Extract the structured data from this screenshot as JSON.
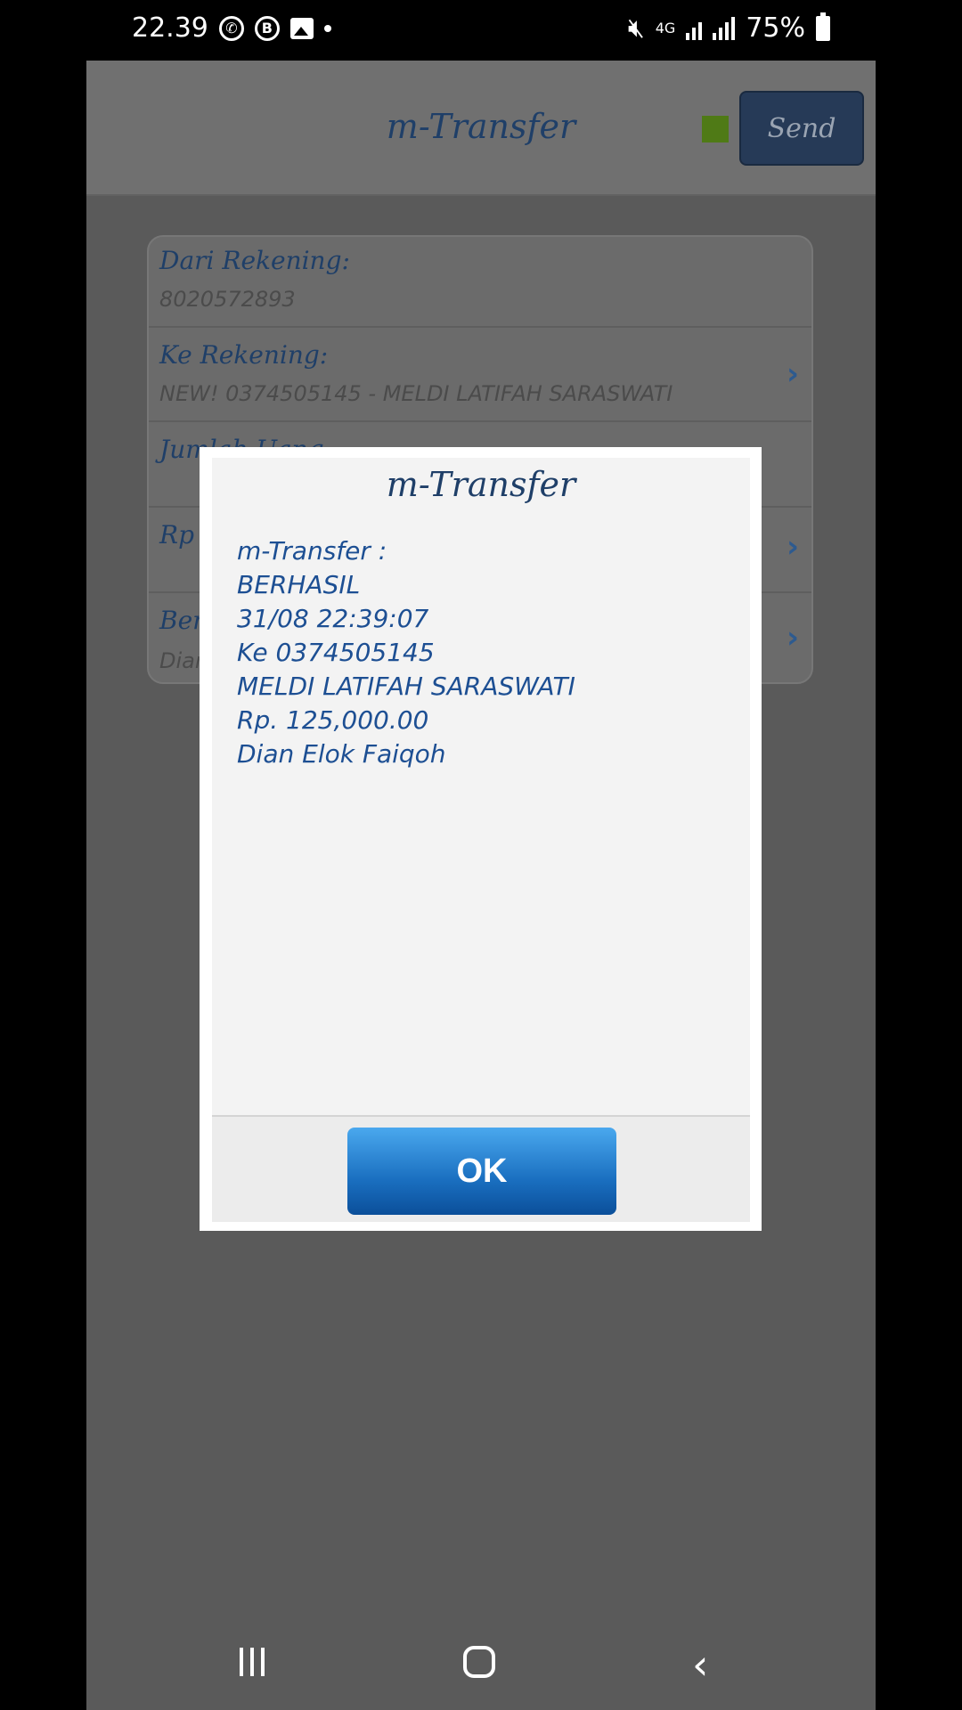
{
  "status_bar": {
    "time": "22.39",
    "battery": "75%",
    "network": "4G",
    "icons": [
      "whatsapp-icon",
      "b-circle-icon",
      "gallery-icon",
      "mute-icon",
      "signal-icon",
      "battery-icon"
    ]
  },
  "header": {
    "title": "m-Transfer",
    "send_label": "Send",
    "status_color": "#4f7a16"
  },
  "form": {
    "rows": [
      {
        "label": "Dari Rekening:",
        "value": "8020572893"
      },
      {
        "label": "Ke Rekening:",
        "value": "NEW! 0374505145 - MELDI LATIFAH SARASWATI"
      },
      {
        "label": "Jumlah Uang",
        "value": ""
      },
      {
        "label": "Rp",
        "value": ""
      },
      {
        "label": "Berita",
        "value": "Dian"
      }
    ]
  },
  "dialog": {
    "title": "m-Transfer",
    "lines": [
      "m-Transfer :",
      "BERHASIL",
      "31/08 22:39:07",
      "Ke 0374505145",
      "MELDI LATIFAH SARASWATI",
      "Rp. 125,000.00",
      "Dian Elok Faiqoh"
    ],
    "ok_label": "OK"
  },
  "colors": {
    "accent": "#1d4f93",
    "ok_button": "#1a6fc0",
    "overlay": "#5a5a5a"
  }
}
